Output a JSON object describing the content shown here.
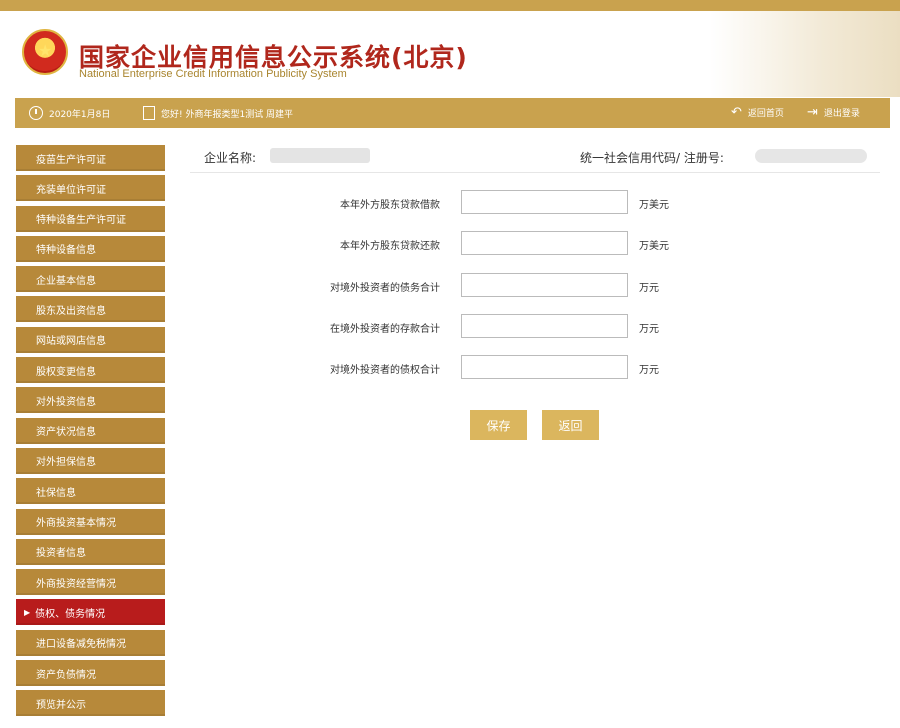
{
  "header": {
    "title_cn": "国家企业信用信息公示系统(北京)",
    "title_en": "National Enterprise Credit Information Publicity System"
  },
  "toolbar": {
    "date": "2020年1月8日",
    "greeting": "您好! 外商年报类型1测试 周建平",
    "back_home": "返回首页",
    "logout": "退出登录"
  },
  "sidebar": {
    "items": [
      {
        "label": "疫苗生产许可证"
      },
      {
        "label": "充装单位许可证"
      },
      {
        "label": "特种设备生产许可证"
      },
      {
        "label": "特种设备信息"
      },
      {
        "label": "企业基本信息"
      },
      {
        "label": "股东及出资信息"
      },
      {
        "label": "网站或网店信息"
      },
      {
        "label": "股权变更信息"
      },
      {
        "label": "对外投资信息"
      },
      {
        "label": "资产状况信息"
      },
      {
        "label": "对外担保信息"
      },
      {
        "label": "社保信息"
      },
      {
        "label": "外商投资基本情况"
      },
      {
        "label": "投资者信息"
      },
      {
        "label": "外商投资经营情况"
      },
      {
        "label": "债权、债务情况"
      },
      {
        "label": "进口设备减免税情况"
      },
      {
        "label": "资产负债情况"
      },
      {
        "label": "预览并公示"
      }
    ],
    "active_index": 15
  },
  "company": {
    "name_label": "企业名称:",
    "name_value": "",
    "credit_label": "统一社会信用代码/ 注册号:",
    "credit_value": ""
  },
  "form": {
    "rows": [
      {
        "label": "本年外方股东贷款借款",
        "value": "",
        "unit": "万美元"
      },
      {
        "label": "本年外方股东贷款还款",
        "value": "",
        "unit": "万美元"
      },
      {
        "label": "对境外投资者的债务合计",
        "value": "",
        "unit": "万元"
      },
      {
        "label": "在境外投资者的存款合计",
        "value": "",
        "unit": "万元"
      },
      {
        "label": "对境外投资者的债权合计",
        "value": "",
        "unit": "万元"
      }
    ]
  },
  "buttons": {
    "save": "保存",
    "back": "返回"
  },
  "colors": {
    "gold": "#c9a24e",
    "sidebar": "#b7893a",
    "active": "#b81c1c",
    "button": "#dbb65e",
    "title_red": "#b0271c"
  }
}
